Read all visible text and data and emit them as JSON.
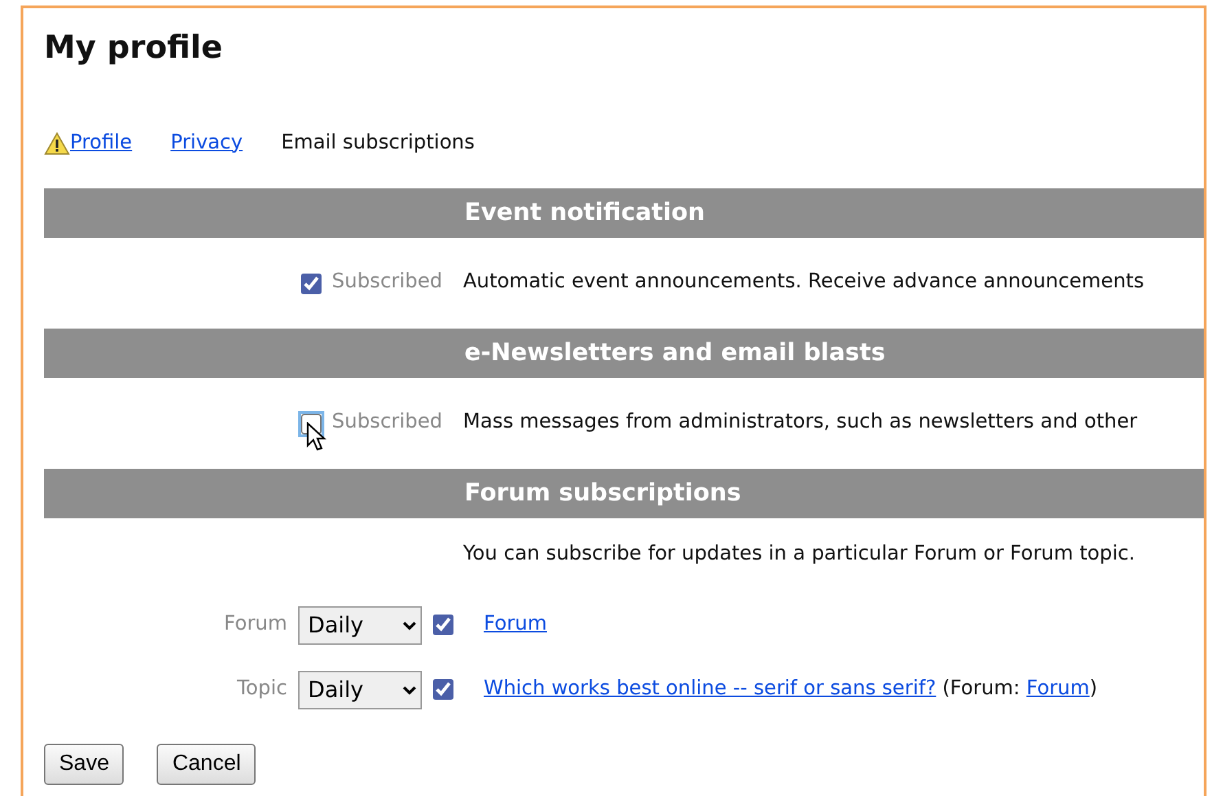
{
  "title": "My profile",
  "tabs": [
    {
      "label": "Profile",
      "selected": false,
      "warning": true
    },
    {
      "label": "Privacy",
      "selected": false,
      "warning": false
    },
    {
      "label": "Email subscriptions",
      "selected": true,
      "warning": false
    }
  ],
  "sections": [
    {
      "heading": "Event notification",
      "kind": "subscription",
      "label": "Subscribed",
      "checked": true,
      "hovered": false,
      "description": "Automatic event announcements. Receive advance announcements"
    },
    {
      "heading": "e-Newsletters and email blasts",
      "kind": "subscription",
      "label": "Subscribed",
      "checked": false,
      "hovered": true,
      "description": "Mass messages from administrators, such as newsletters and other"
    },
    {
      "heading": "Forum subscriptions",
      "kind": "forum",
      "intro": "You can subscribe for updates in a particular Forum or Forum topic.",
      "rows": [
        {
          "label": "Forum",
          "frequency": "Daily",
          "checked": true,
          "link": "Forum"
        },
        {
          "label": "Topic",
          "frequency": "Daily",
          "checked": true,
          "link": "Which works best online -- serif or sans serif?",
          "note_open": "(Forum:",
          "note_link": "Forum",
          "note_close": ")"
        }
      ]
    }
  ],
  "buttons": [
    "Save",
    "Cancel"
  ]
}
